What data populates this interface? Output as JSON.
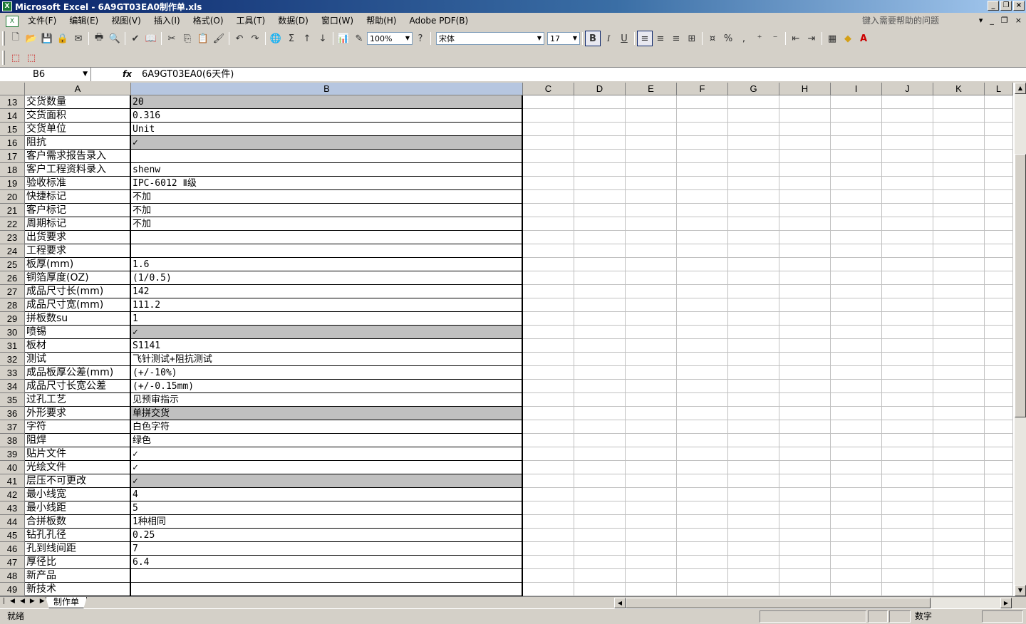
{
  "window": {
    "title": "Microsoft Excel - 6A9GT03EA0制作单.xls"
  },
  "menu": [
    "文件(F)",
    "编辑(E)",
    "视图(V)",
    "插入(I)",
    "格式(O)",
    "工具(T)",
    "数据(D)",
    "窗口(W)",
    "帮助(H)",
    "Adobe PDF(B)"
  ],
  "help_placeholder": "键入需要帮助的问题",
  "toolbar": {
    "zoom": "100%",
    "font": "宋体",
    "font_size": "17",
    "bold": "B",
    "italic": "I",
    "underline": "U"
  },
  "formula": {
    "cell_ref": "B6",
    "fx": "fx",
    "content": "6A9GT03EA0(6天件)"
  },
  "columns": [
    "A",
    "B",
    "C",
    "D",
    "E",
    "F",
    "G",
    "H",
    "I",
    "J",
    "K",
    "L"
  ],
  "rows": [
    {
      "n": "13",
      "a": "交货数量",
      "b": "20",
      "gray": true
    },
    {
      "n": "14",
      "a": "交货面积",
      "b": "0.316",
      "gray": false
    },
    {
      "n": "15",
      "a": "交货单位",
      "b": "Unit",
      "gray": false
    },
    {
      "n": "16",
      "a": "阻抗",
      "b": "✓",
      "gray": true
    },
    {
      "n": "17",
      "a": "客户需求报告录入",
      "b": "",
      "gray": false
    },
    {
      "n": "18",
      "a": "客户工程资料录入",
      "b": "shenw",
      "gray": false
    },
    {
      "n": "19",
      "a": "验收标准",
      "b": "IPC-6012 Ⅱ级",
      "gray": false
    },
    {
      "n": "20",
      "a": "快捷标记",
      "b": "不加",
      "gray": false
    },
    {
      "n": "21",
      "a": "客户标记",
      "b": "不加",
      "gray": false
    },
    {
      "n": "22",
      "a": "周期标记",
      "b": "不加",
      "gray": false
    },
    {
      "n": "23",
      "a": "出货要求",
      "b": "",
      "gray": false
    },
    {
      "n": "24",
      "a": "工程要求",
      "b": "",
      "gray": false
    },
    {
      "n": "25",
      "a": "板厚(mm)",
      "b": "1.6",
      "gray": false
    },
    {
      "n": "26",
      "a": "铜箔厚度(OZ)",
      "b": "(1/0.5)",
      "gray": false
    },
    {
      "n": "27",
      "a": "成品尺寸长(mm)",
      "b": "142",
      "gray": false
    },
    {
      "n": "28",
      "a": "成品尺寸宽(mm)",
      "b": "111.2",
      "gray": false
    },
    {
      "n": "29",
      "a": "拼板数su",
      "b": "1",
      "gray": false
    },
    {
      "n": "30",
      "a": "喷锡",
      "b": "✓",
      "gray": true
    },
    {
      "n": "31",
      "a": "板材",
      "b": "S1141",
      "gray": false
    },
    {
      "n": "32",
      "a": "测试",
      "b": "飞针测试+阻抗测试",
      "gray": false
    },
    {
      "n": "33",
      "a": "成品板厚公差(mm)",
      "b": "(+/-10%)",
      "gray": false
    },
    {
      "n": "34",
      "a": "成品尺寸长宽公差",
      "b": "(+/-0.15mm)",
      "gray": false
    },
    {
      "n": "35",
      "a": "过孔工艺",
      "b": "见预审指示",
      "gray": false
    },
    {
      "n": "36",
      "a": "外形要求",
      "b": "单拼交货",
      "gray": true
    },
    {
      "n": "37",
      "a": "字符",
      "b": "白色字符",
      "gray": false
    },
    {
      "n": "38",
      "a": "阻焊",
      "b": "绿色",
      "gray": false
    },
    {
      "n": "39",
      "a": "贴片文件",
      "b": "✓",
      "gray": false
    },
    {
      "n": "40",
      "a": "光绘文件",
      "b": "✓",
      "gray": false
    },
    {
      "n": "41",
      "a": "层压不可更改",
      "b": "✓",
      "gray": true
    },
    {
      "n": "42",
      "a": "最小线宽",
      "b": "4",
      "gray": false
    },
    {
      "n": "43",
      "a": "最小线距",
      "b": "5",
      "gray": false
    },
    {
      "n": "44",
      "a": "合拼板数",
      "b": "1种相同",
      "gray": false
    },
    {
      "n": "45",
      "a": "钻孔孔径",
      "b": "0.25",
      "gray": false
    },
    {
      "n": "46",
      "a": "孔到线间距",
      "b": "7",
      "gray": false
    },
    {
      "n": "47",
      "a": "厚径比",
      "b": "6.4",
      "gray": false
    },
    {
      "n": "48",
      "a": "新产品",
      "b": "",
      "gray": false
    },
    {
      "n": "49",
      "a": "新技术",
      "b": "",
      "gray": false
    }
  ],
  "sheet_tab": "制作单",
  "status": {
    "ready": "就绪",
    "mode": "数字"
  }
}
